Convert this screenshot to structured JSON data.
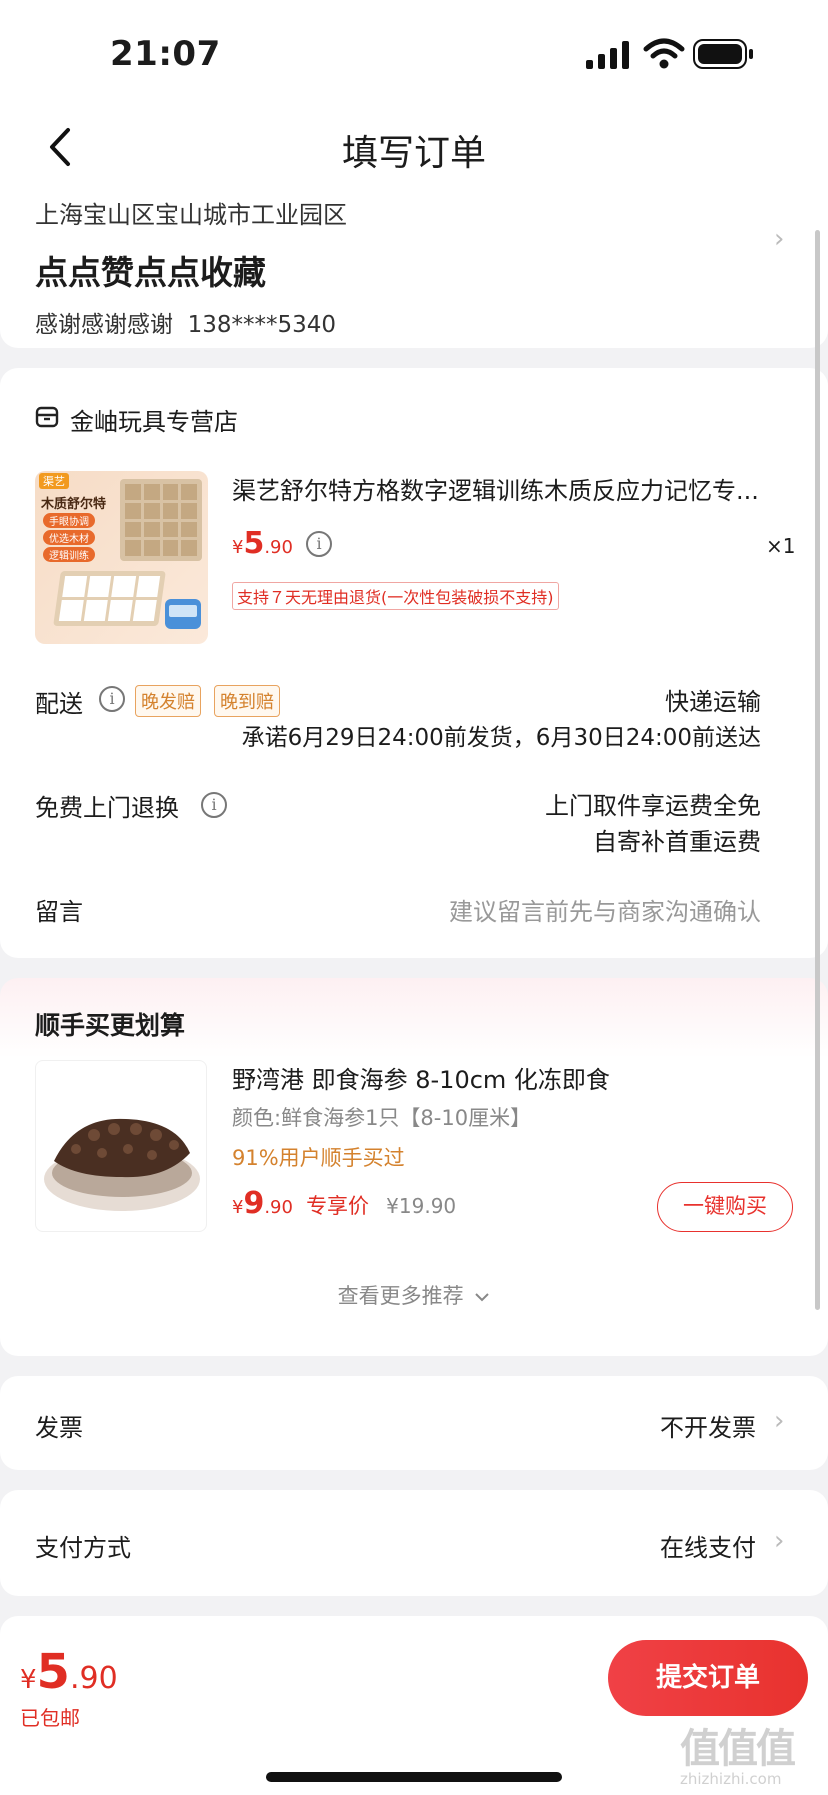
{
  "status": {
    "time": "21:07"
  },
  "nav": {
    "title": "填写订单"
  },
  "address": {
    "region": "上海宝山区宝山城市工业园区",
    "detail": "点点赞点点收藏",
    "contact": "感谢感谢感谢  138****5340"
  },
  "store": {
    "name": "金岫玩具专营店"
  },
  "product": {
    "name": "渠艺舒尔特方格数字逻辑训练木质反应力记忆专...",
    "currency": "¥",
    "price_int": "5",
    "price_dec": ".90",
    "qty": "×1",
    "return_policy": "支持７天无理由退货(一次性包装破损不支持)",
    "image_text": {
      "brand": "渠艺",
      "title": "木质舒尔特",
      "tags": [
        "手眼协调",
        "优选木材",
        "逻辑训练"
      ]
    }
  },
  "delivery": {
    "label": "配送",
    "badges": [
      "晚发赔",
      "晚到赔"
    ],
    "method": "快递运输",
    "promise": "承诺6月29日24:00前发货，6月30日24:00前送达"
  },
  "returns": {
    "label": "免费上门退换",
    "line1": "上门取件享运费全免",
    "line2": "自寄补首重运费"
  },
  "message": {
    "label": "留言",
    "placeholder": "建议留言前先与商家沟通确认"
  },
  "addon": {
    "section_title": "顺手买更划算",
    "name": "野湾港 即食海参 8-10cm 化冻即食",
    "spec": "颜色:鲜食海参1只【8-10厘米】",
    "social": "91%用户顺手买过",
    "currency": "¥",
    "price_int": "9",
    "price_dec": ".90",
    "price_tag": "专享价",
    "original_price": "¥19.90",
    "buy_button": "一键购买",
    "more": "查看更多推荐"
  },
  "invoice": {
    "label": "发票",
    "value": "不开发票"
  },
  "payment": {
    "label": "支付方式",
    "value": "在线支付"
  },
  "footer": {
    "currency": "¥",
    "price_int": "5",
    "price_dec": ".90",
    "shipping": "已包邮",
    "submit": "提交订单"
  },
  "watermark": {
    "text": "值值值",
    "site": "zhizhizhi.com"
  },
  "colors": {
    "accent": "#e8322e",
    "price": "#e02e24",
    "bg": "#f2f2f4",
    "orange": "#d4822e"
  }
}
